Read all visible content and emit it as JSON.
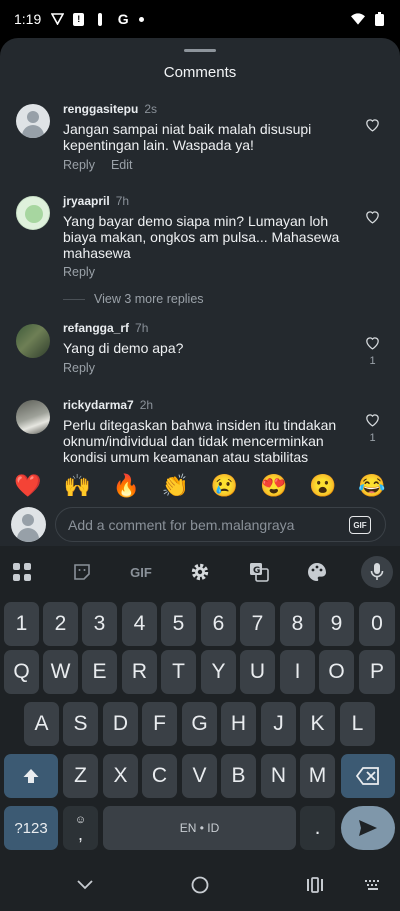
{
  "status_bar": {
    "time": "1:19",
    "icons": [
      "vpn-key-icon",
      "notification-icon",
      "location-icon",
      "google-icon",
      "more-dot-icon"
    ],
    "right_icons": [
      "wifi-icon",
      "battery-icon"
    ]
  },
  "sheet": {
    "title": "Comments"
  },
  "comments": [
    {
      "username": "renggasitepu",
      "time": "2s",
      "text": "Jangan sampai niat baik malah disusupi kepentingan lain. Waspada ya!",
      "actions": [
        "Reply",
        "Edit"
      ],
      "likes": ""
    },
    {
      "username": "jryaapril",
      "time": "7h",
      "text": "Yang bayar demo siapa min? Lumayan loh biaya makan, ongkos am pulsa... Mahasewa mahasewa",
      "actions": [
        "Reply"
      ],
      "likes": "",
      "more_replies": "View 3 more replies"
    },
    {
      "username": "refangga_rf",
      "time": "7h",
      "text": "Yang di demo apa?",
      "actions": [
        "Reply"
      ],
      "likes": "1"
    },
    {
      "username": "rickydarma7",
      "time": "2h",
      "text": "Perlu ditegaskan bahwa insiden itu tindakan oknum/individual dan tidak mencerminkan kondisi umum keamanan atau stabilitas",
      "actions": [],
      "likes": "1"
    }
  ],
  "emoji_bar": [
    "❤️",
    "🙌",
    "🔥",
    "👏",
    "😢",
    "😍",
    "😮",
    "😂"
  ],
  "comment_input": {
    "placeholder": "Add a comment for bem.malangraya",
    "gif_label": "GIF"
  },
  "keyboard": {
    "toolbar": {
      "gif_label": "GIF",
      "items": [
        "apps-grid-icon",
        "sticker-icon",
        "gif-icon",
        "settings-gear-icon",
        "translate-icon",
        "palette-icon",
        "microphone-icon"
      ]
    },
    "rows": {
      "numbers": [
        "1",
        "2",
        "3",
        "4",
        "5",
        "6",
        "7",
        "8",
        "9",
        "0"
      ],
      "row1": [
        "Q",
        "W",
        "E",
        "R",
        "T",
        "Y",
        "U",
        "I",
        "O",
        "P"
      ],
      "row2": [
        "A",
        "S",
        "D",
        "F",
        "G",
        "H",
        "J",
        "K",
        "L"
      ],
      "row3": [
        "Z",
        "X",
        "C",
        "V",
        "B",
        "N",
        "M"
      ]
    },
    "symbols_key": "?123",
    "comma_key": ",",
    "space_label": "EN • ID",
    "period_key": "."
  },
  "nav_bar": {
    "items": [
      "back-chevron-icon",
      "home-circle-icon",
      "recents-icon",
      "keyboard-switch-icon"
    ]
  }
}
